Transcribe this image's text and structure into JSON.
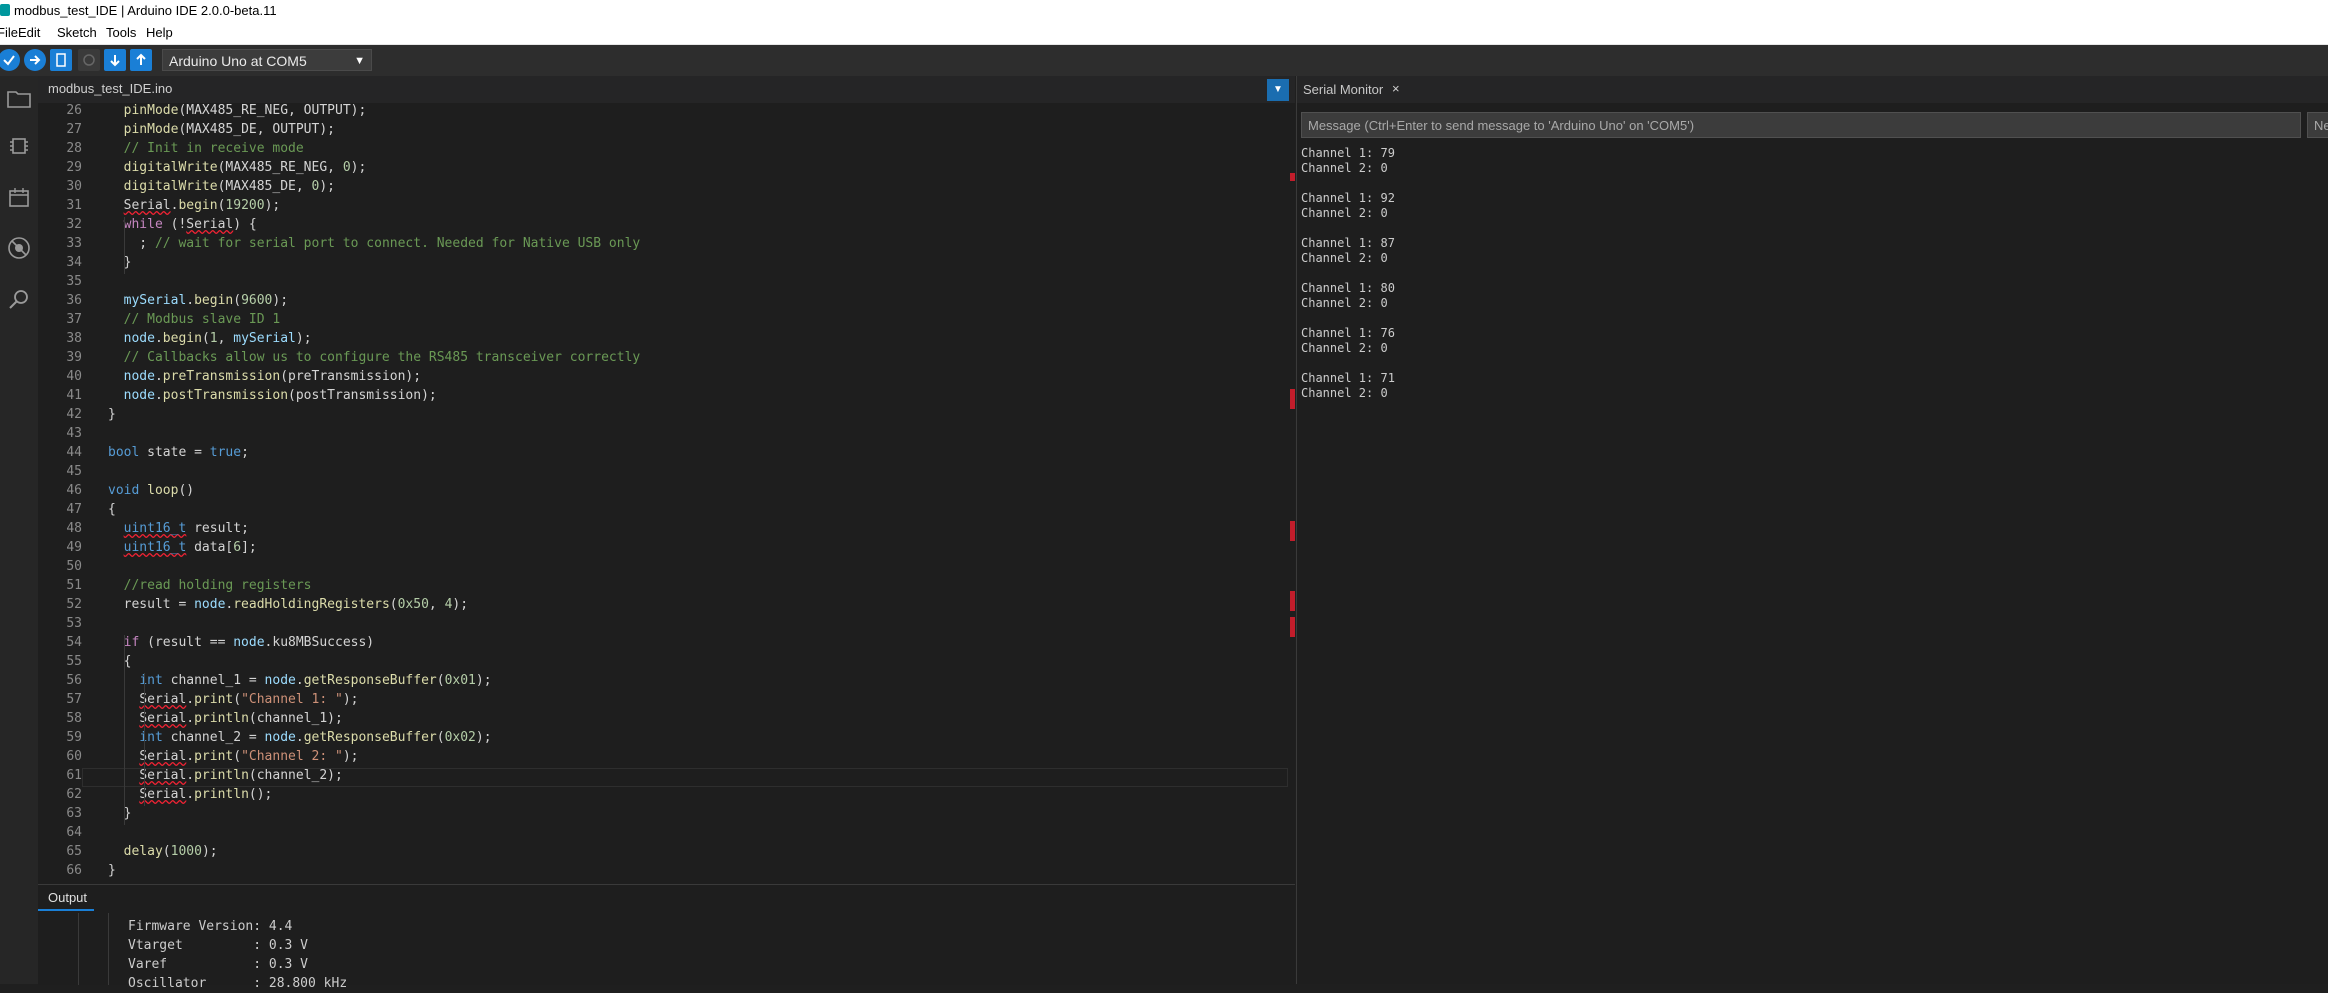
{
  "window": {
    "title": "modbus_test_IDE | Arduino IDE 2.0.0-beta.11"
  },
  "menu": [
    "File",
    "Edit",
    "Sketch",
    "Tools",
    "Help"
  ],
  "toolbar": {
    "verify_icon": "check-icon",
    "upload_icon": "arrow-right-icon",
    "board": "Arduino Uno at COM5"
  },
  "editor": {
    "tab_name": "modbus_test_IDE.ino",
    "line_numbers": [
      "26",
      "27",
      "28",
      "29",
      "30",
      "31",
      "32",
      "33",
      "34",
      "35",
      "36",
      "37",
      "38",
      "39",
      "40",
      "41",
      "42",
      "43",
      "44",
      "45",
      "46",
      "47",
      "48",
      "49",
      "50",
      "51",
      "52",
      "53",
      "54",
      "55",
      "56",
      "57",
      "58",
      "59",
      "60",
      "61",
      "62",
      "63",
      "64",
      "65",
      "66"
    ],
    "lines": [
      "  pinMode(MAX485_RE_NEG, OUTPUT);",
      "  pinMode(MAX485_DE, OUTPUT);",
      "  // Init in receive mode",
      "  digitalWrite(MAX485_RE_NEG, 0);",
      "  digitalWrite(MAX485_DE, 0);",
      "  Serial.begin(19200);",
      "  while (!Serial) {",
      "    ; // wait for serial port to connect. Needed for Native USB only",
      "  }",
      "",
      "  mySerial.begin(9600);",
      "  // Modbus slave ID 1",
      "  node.begin(1, mySerial);",
      "  // Callbacks allow us to configure the RS485 transceiver correctly",
      "  node.preTransmission(preTransmission);",
      "  node.postTransmission(postTransmission);",
      "}",
      "",
      "bool state = true;",
      "",
      "void loop()",
      "{",
      "  uint16_t result;",
      "  uint16_t data[6];",
      "",
      "  //read holding registers",
      "  result = node.readHoldingRegisters(0x50, 4);",
      "",
      "  if (result == node.ku8MBSuccess)",
      "  {",
      "    int channel_1 = node.getResponseBuffer(0x01);",
      "    Serial.print(\"Channel 1: \");",
      "    Serial.println(channel_1);",
      "    int channel_2 = node.getResponseBuffer(0x02);",
      "    Serial.print(\"Channel 2: \");",
      "    Serial.println(channel_2);",
      "    Serial.println();",
      "  }",
      "",
      "  delay(1000);",
      "}"
    ]
  },
  "serial_monitor": {
    "tab": "Serial Monitor",
    "close_glyph": "×",
    "message_placeholder": "Message (Ctrl+Enter to send message to 'Arduino Uno' on 'COM5')",
    "line_ending": "New",
    "output": "Channel 1: 79\nChannel 2: 0\n\nChannel 1: 92\nChannel 2: 0\n\nChannel 1: 87\nChannel 2: 0\n\nChannel 1: 80\nChannel 2: 0\n\nChannel 1: 76\nChannel 2: 0\n\nChannel 1: 71\nChannel 2: 0"
  },
  "output_panel": {
    "tab": "Output",
    "text": "Firmware Version: 4.4\nVtarget         : 0.3 V\nVaref           : 0.3 V\nOscillator      : 28.800 kHz"
  },
  "colors": {
    "accent": "#1a7fd6",
    "error_mark": "#c21d2b"
  }
}
